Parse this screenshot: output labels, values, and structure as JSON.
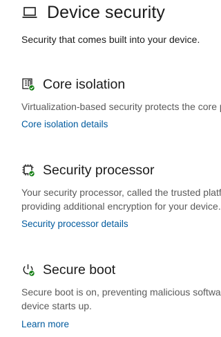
{
  "header": {
    "title": "Device security",
    "subtitle": "Security that comes built into your device.",
    "icon": "laptop-icon"
  },
  "sections": [
    {
      "id": "core-isolation",
      "title": "Core isolation",
      "description": "Virtualization-based security protects the core parts of your device.",
      "link": "Core isolation details",
      "icon": "core-isolation-icon",
      "status": "ok"
    },
    {
      "id": "security-processor",
      "title": "Security processor",
      "description_line1": "Your security processor, called the trusted platform module (TPM), is",
      "description_line2": "providing additional encryption for your device.",
      "link": "Security processor details",
      "icon": "chip-icon",
      "status": "ok"
    },
    {
      "id": "secure-boot",
      "title": "Secure boot",
      "description_line1": "Secure boot is on, preventing malicious software from loading when your",
      "description_line2": "device starts up.",
      "link": "Learn more",
      "icon": "power-icon",
      "status": "ok"
    }
  ],
  "colors": {
    "link": "#005a9e",
    "text": "#1b1b1b",
    "muted": "#5a5a5a",
    "status_ok": "#107c10"
  }
}
